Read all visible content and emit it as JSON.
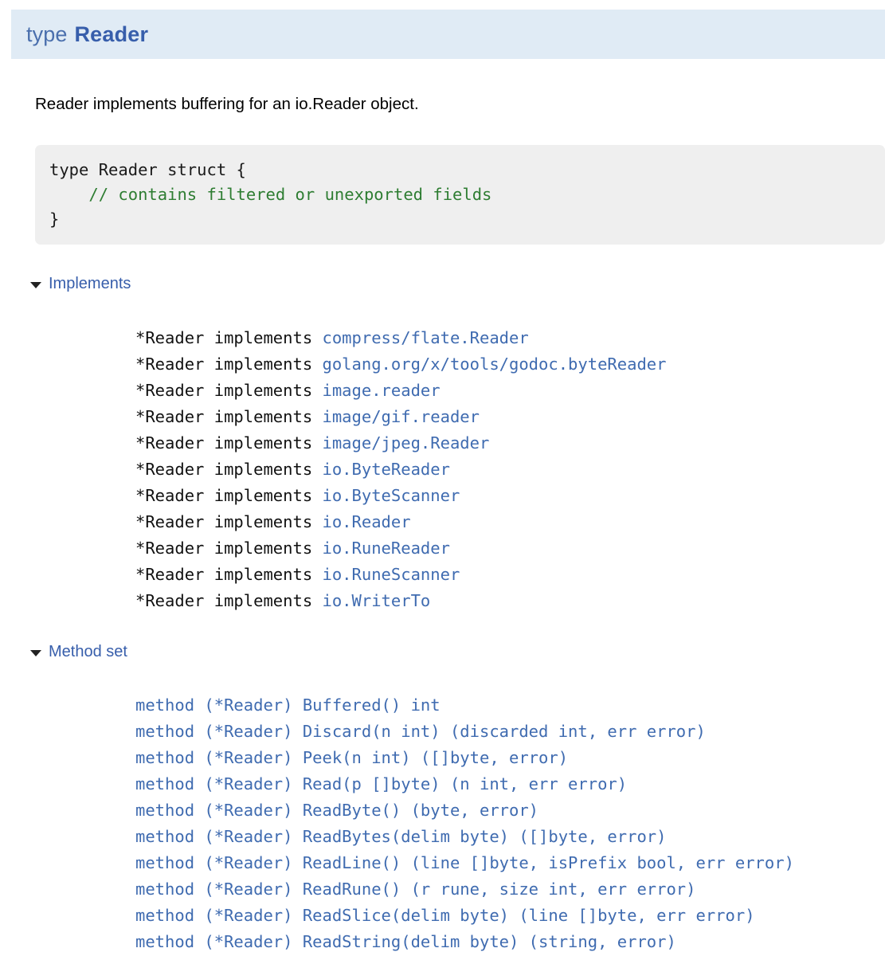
{
  "header": {
    "keyword": "type",
    "name": "Reader",
    "bg_color": "#e0ebf5",
    "accent_color": "#375eab"
  },
  "description": "Reader implements buffering for an io.Reader object.",
  "code_block": {
    "line1": "type Reader struct {",
    "line2_indent": "    ",
    "line2_comment": "// contains filtered or unexported fields",
    "line3": "}",
    "background": "#efefef",
    "comment_color": "#2e7d32"
  },
  "sections": {
    "implements": {
      "label": "Implements",
      "expanded": true,
      "marker": "triangle-down-icon",
      "items": [
        {
          "prefix": "*Reader implements ",
          "target": "compress/flate.Reader"
        },
        {
          "prefix": "*Reader implements ",
          "target": "golang.org/x/tools/godoc.byteReader"
        },
        {
          "prefix": "*Reader implements ",
          "target": "image.reader"
        },
        {
          "prefix": "*Reader implements ",
          "target": "image/gif.reader"
        },
        {
          "prefix": "*Reader implements ",
          "target": "image/jpeg.Reader"
        },
        {
          "prefix": "*Reader implements ",
          "target": "io.ByteReader"
        },
        {
          "prefix": "*Reader implements ",
          "target": "io.ByteScanner"
        },
        {
          "prefix": "*Reader implements ",
          "target": "io.Reader"
        },
        {
          "prefix": "*Reader implements ",
          "target": "io.RuneReader"
        },
        {
          "prefix": "*Reader implements ",
          "target": "io.RuneScanner"
        },
        {
          "prefix": "*Reader implements ",
          "target": "io.WriterTo"
        }
      ]
    },
    "method_set": {
      "label": "Method set",
      "expanded": true,
      "marker": "triangle-down-icon",
      "items": [
        "method (*Reader) Buffered() int",
        "method (*Reader) Discard(n int) (discarded int, err error)",
        "method (*Reader) Peek(n int) ([]byte, error)",
        "method (*Reader) Read(p []byte) (n int, err error)",
        "method (*Reader) ReadByte() (byte, error)",
        "method (*Reader) ReadBytes(delim byte) ([]byte, error)",
        "method (*Reader) ReadLine() (line []byte, isPrefix bool, err error)",
        "method (*Reader) ReadRune() (r rune, size int, err error)",
        "method (*Reader) ReadSlice(delim byte) (line []byte, err error)",
        "method (*Reader) ReadString(delim byte) (string, error)"
      ]
    }
  }
}
